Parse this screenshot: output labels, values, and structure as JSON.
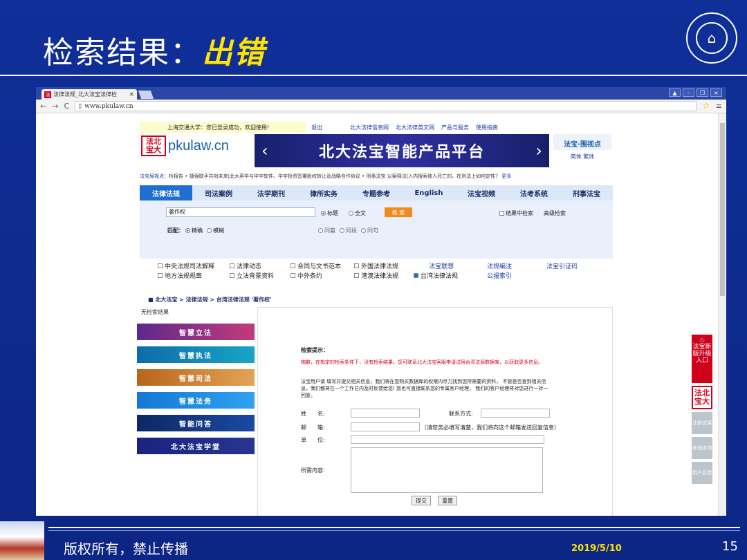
{
  "slide": {
    "title_prefix": "检索结果：",
    "title_highlight": "出错",
    "footer_left": "版权所有，禁止传播",
    "footer_date": "2019/5/10",
    "page_number": "15"
  },
  "browser": {
    "tab_title": "法律法规_北大法宝法律检",
    "tab_close": "×",
    "url": "www.pkulaw.cn",
    "win_buttons": [
      "▲",
      "–",
      "❐",
      "×"
    ]
  },
  "site": {
    "login_msg": "上海交通大学：您已登录成功，欢迎使用!",
    "top_links": [
      "退出",
      "北大法律信息网",
      "北大法律英文网",
      "产品与服务",
      "使用指南"
    ],
    "logo_mark": "法北宝大",
    "logo_text": "pkulaw.cn",
    "banner_title": "北大法宝智能产品平台",
    "banner_prev": "‹",
    "banner_next": "›",
    "view_title": "法宝·围视点",
    "view_lang": "简体 繁体",
    "news_label": "法宝局视点：",
    "news_text": "析报告  • 捷强联手共创未来|北大英华与华宇软件、华宇投资签署股权转让及战略合作协议  • 刑事法宝 以案释法|入内搜索致人死亡的，在刑法上如何定性？",
    "news_more": "更多",
    "nav": [
      "法律法规",
      "司法案例",
      "法学期刊",
      "律所实务",
      "专题参考",
      "English",
      "法宝视频",
      "法考系统",
      "刑事法宝"
    ],
    "search": {
      "value": "著作权",
      "opt_title": "标题",
      "opt_full": "全文",
      "button": "检 索",
      "in_result": "结果中检索",
      "advanced": "高级检索",
      "match_label": "匹配：",
      "match_exact": "精确",
      "match_fuzzy": "模糊",
      "scope": [
        "同篇",
        "同段",
        "同句"
      ]
    },
    "databases": {
      "row1": [
        "中央法规司法解释",
        "法律动态",
        "合同与文书范本",
        "外国法律法规"
      ],
      "row2": [
        "地方法规规章",
        "立法背景资料",
        "中外条约",
        "港澳法律法规",
        "台湾法律法规"
      ],
      "links_row1": [
        "法宝联想",
        "法规编注",
        "法宝引证码"
      ],
      "links_row2": [
        "公报索引"
      ]
    },
    "breadcrumb": "■  北大法宝 > 法律法规 > 台湾法律法规 '著作权'",
    "no_result": "无检索结果",
    "side_menu": [
      "智慧立法",
      "智慧执法",
      "智慧司法",
      "智慧法务",
      "智能问答",
      "北大法宝学堂"
    ],
    "tips": {
      "heading": "检索提示：",
      "red_text": "抱歉，在指定的检索条件下，没有检索结果。您可联系北大法宝客服申请试用台湾法源数据库，以获取更多信息。",
      "body_text": "法宝用户请 填写并提交相关信息，我们将在您购买数据库的权限内尽力找到您所需要的资料， 不管是否查到相关信息，我们都将在一个工作日内及时反馈给您! 您也可直接联系您的专属客户经理， 我们的客户经理将对您进行一对一回复。"
    },
    "form": {
      "name": "姓　　名:",
      "contact": "联系方式:",
      "email": "邮　　箱:",
      "email_note": "（请您务必填写清楚，我们将向这个邮箱发送回复信息）",
      "org": "单　　位:",
      "content": "所需内容:",
      "submit": "提交",
      "reset": "重置"
    },
    "right_bar": {
      "upgrade": "法宝新版升级入口",
      "logo": "法北宝大",
      "register": "注册试用",
      "consult": "在线咨询",
      "feedback": "用户反馈"
    }
  }
}
